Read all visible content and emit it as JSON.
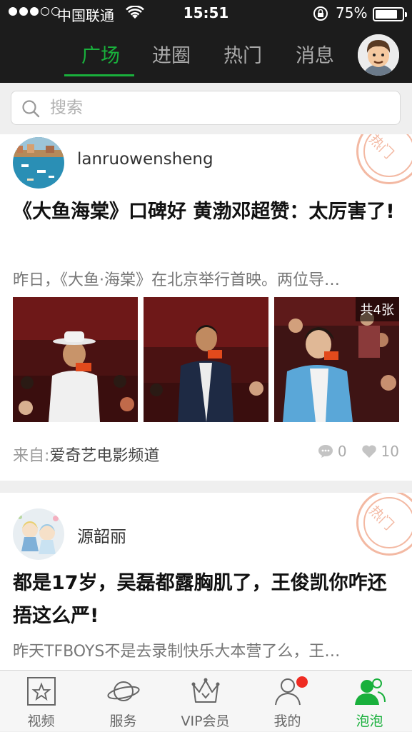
{
  "status_bar": {
    "carrier": "中国联通",
    "time": "15:51",
    "battery_pct": "75%",
    "signal_bars": 3,
    "battery_level": 0.75
  },
  "top_nav": {
    "tabs": [
      {
        "label": "广场",
        "active": true
      },
      {
        "label": "进圈",
        "active": false
      },
      {
        "label": "热门",
        "active": false
      },
      {
        "label": "消息",
        "active": false
      }
    ],
    "accent_color": "#19b03c"
  },
  "search": {
    "placeholder": "搜索"
  },
  "feed": [
    {
      "author": "lanruowensheng",
      "title": "《大鱼海棠》口碑好 黄渤邓超赞：太厉害了!",
      "summary": "昨日，《大鱼·海棠》在北京举行首映。两位导…",
      "hot_label": "热门",
      "photo_count": "共4张",
      "source_prefix": "来自:",
      "source_name": "爱奇艺电影频道",
      "comments": "0",
      "likes": "10"
    },
    {
      "author": "源韶丽",
      "title": "都是17岁，吴磊都露胸肌了，王俊凯你咋还捂这么严!",
      "summary": "昨天TFBOYS不是去录制快乐大本营了么，王…",
      "hot_label": "热门"
    }
  ],
  "tab_bar": {
    "items": [
      {
        "label": "视频",
        "icon": "video-star-icon",
        "active": false
      },
      {
        "label": "服务",
        "icon": "planet-icon",
        "active": false
      },
      {
        "label": "VIP会员",
        "icon": "crown-icon",
        "active": false
      },
      {
        "label": "我的",
        "icon": "person-icon",
        "active": false,
        "badge": true
      },
      {
        "label": "泡泡",
        "icon": "bubble-people-icon",
        "active": true
      }
    ]
  }
}
